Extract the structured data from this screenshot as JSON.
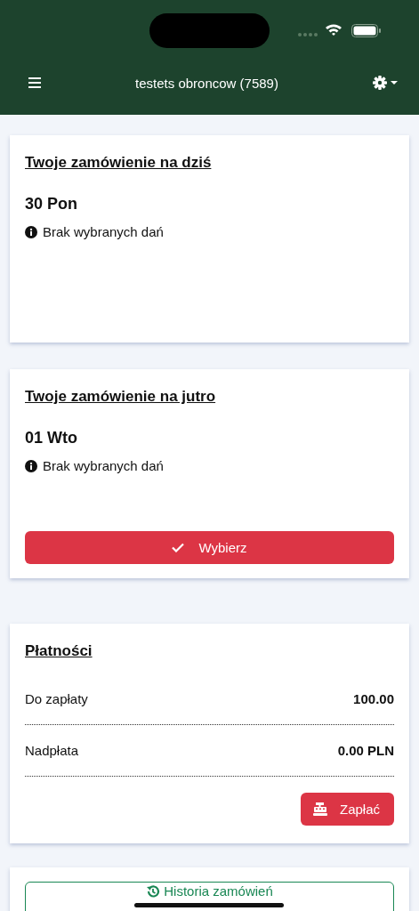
{
  "header": {
    "title": "testets obroncow (7589)"
  },
  "orders": [
    {
      "title": "Twoje zamówienie na dziś",
      "day": "30 Pon",
      "info": "Brak wybranych dań"
    },
    {
      "title": "Twoje zamówienie na jutro",
      "day": "01 Wto",
      "info": "Brak wybranych dań",
      "button": "Wybierz"
    }
  ],
  "payments": {
    "title": "Płatności",
    "rows": [
      {
        "label": "Do zapłaty",
        "value": "100.00"
      },
      {
        "label": "Nadpłata",
        "value": "0.00 PLN"
      }
    ],
    "button": "Zapłać"
  },
  "history_button": "Historia zamówień"
}
